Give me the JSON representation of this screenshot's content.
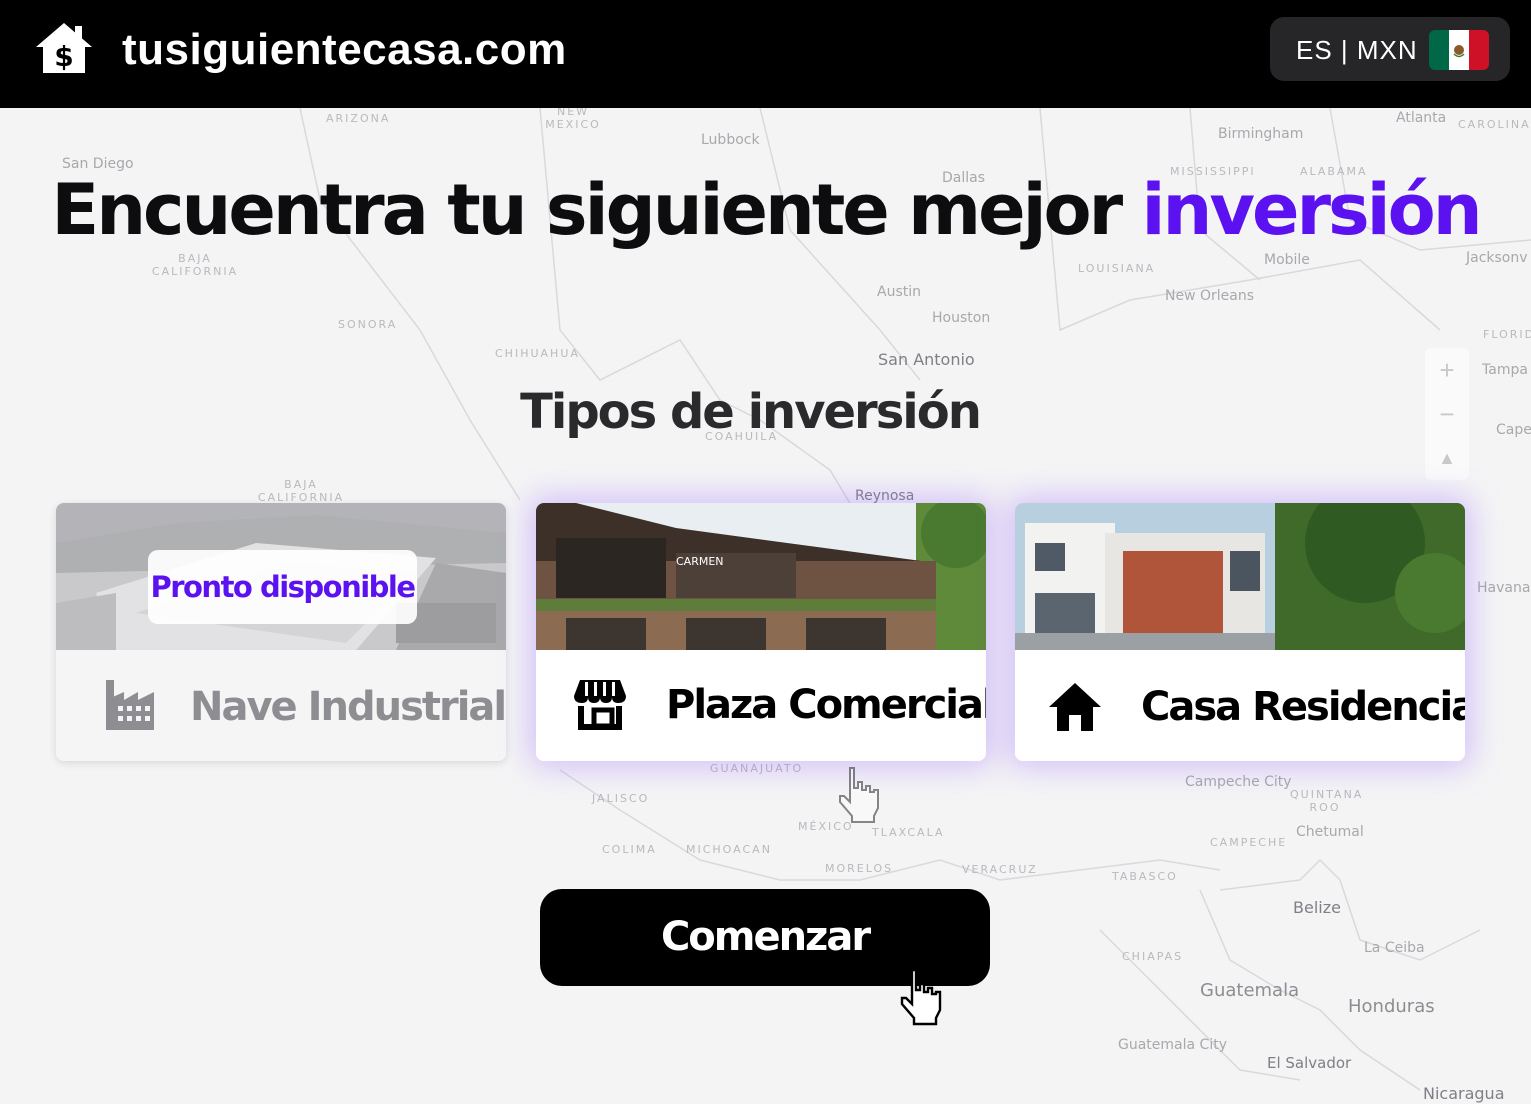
{
  "header": {
    "site_name": "tusiguientecasa.com",
    "logo_icon": "house-dollar-icon",
    "locale_label": "ES | MXN",
    "flag_icon": "mexico-flag-icon",
    "flag_colors": [
      "#006847",
      "#ffffff",
      "#ce1126"
    ]
  },
  "hero": {
    "title_main": "Encuentra tu siguiente mejor ",
    "title_accent": "inversión",
    "accent_color": "#5b11f0"
  },
  "section": {
    "subtitle": "Tipos de inversión"
  },
  "map_controls": {
    "zoom_in": "+",
    "zoom_out": "−",
    "compass": "▲"
  },
  "map_labels": {
    "arizona": "ARIZONA",
    "new_mexico": "NEW MEXICO",
    "lubbock": "Lubbock",
    "birmingham": "Birmingham",
    "atlanta": "Atlanta",
    "carolina": "CAROLINA",
    "san_diego": "San Diego",
    "dallas": "Dallas",
    "mississippi": "MISSISSIPPI",
    "alabama": "ALABAMA",
    "baja_california": "BAJA CALIFORNIA",
    "louisiana": "LOUISIANA",
    "mobile": "Mobile",
    "jacksonville": "Jacksonv",
    "austin": "Austin",
    "new_orleans": "New Orleans",
    "houston": "Houston",
    "sonora": "SONORA",
    "florida": "FLORID",
    "chihuahua": "CHIHUAHUA",
    "san_antonio": "San Antonio",
    "tampa": "Tampa",
    "cape": "Cape",
    "coahuila": "COAHUILA",
    "baja_california_sur": "BAJA CALIFORNIA",
    "reynosa": "Reynosa",
    "havana": "Havana",
    "guanajuato": "GUANAJUATO",
    "campeche_city": "Campeche City",
    "quintana_roo": "QUINTANA ROO",
    "jalisco": "JALISCO",
    "mexico": "MÉXICO",
    "tlaxcala": "TLAXCALA",
    "chetumal": "Chetumal",
    "campeche": "CAMPECHE",
    "colima": "COLIMA",
    "michoacan": "MICHOACAN",
    "morelos": "MORELOS",
    "veracruz": "VERACRUZ",
    "tabasco": "TABASCO",
    "belize": "Belize",
    "chiapas": "CHIAPAS",
    "la_ceiba": "La Ceiba",
    "guatemala": "Guatemala",
    "honduras": "Honduras",
    "guatemala_city": "Guatemala City",
    "el_salvador": "El Salvador",
    "nicaragua": "Nicaragua"
  },
  "cards": [
    {
      "label": "Nave Industrial",
      "icon": "factory-icon",
      "status": "disabled",
      "badge": "Pronto disponible"
    },
    {
      "label": "Plaza Comercial",
      "icon": "storefront-icon",
      "status": "selected",
      "photo_sign": "CARMEN"
    },
    {
      "label": "Casa Residencial",
      "icon": "home-icon",
      "status": "selected"
    }
  ],
  "cta": {
    "label": "Comenzar"
  }
}
